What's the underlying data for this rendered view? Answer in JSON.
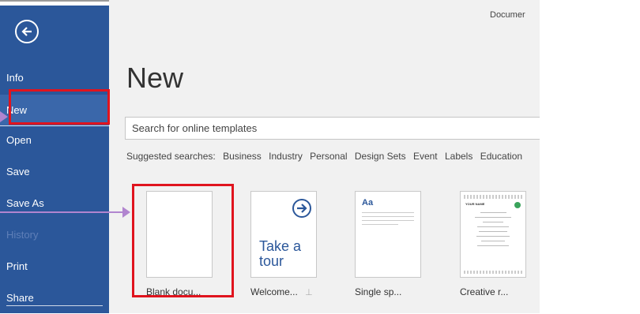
{
  "window": {
    "title": "Documer"
  },
  "sidebar": {
    "back_icon": "arrow-left-circle-icon",
    "items": [
      {
        "label": "Info",
        "state": "normal"
      },
      {
        "label": "New",
        "state": "selected"
      },
      {
        "label": "Open",
        "state": "normal"
      },
      {
        "label": "Save",
        "state": "normal"
      },
      {
        "label": "Save As",
        "state": "normal"
      },
      {
        "label": "History",
        "state": "disabled"
      },
      {
        "label": "Print",
        "state": "normal"
      },
      {
        "label": "Share",
        "state": "normal"
      }
    ]
  },
  "main": {
    "title": "New",
    "search": {
      "placeholder": "Search for online templates"
    },
    "suggested": {
      "label": "Suggested searches:",
      "items": [
        "Business",
        "Industry",
        "Personal",
        "Design Sets",
        "Event",
        "Labels",
        "Education"
      ]
    },
    "templates": [
      {
        "label": "Blank docu...",
        "highlighted": true
      },
      {
        "label": "Welcome...",
        "thumb_text": "Take a tour",
        "pin_icon": "pin-icon"
      },
      {
        "label": "Single sp...",
        "thumb_text": "Aa"
      },
      {
        "label": "Creative r...",
        "thumb_text": "YOUR NAME"
      }
    ]
  },
  "annotations": {
    "highlight_color": "#e0141e",
    "arrow_color": "#b185cf"
  },
  "colors": {
    "sidebar": "#2b579a",
    "content_bg": "#f1f1f1"
  }
}
